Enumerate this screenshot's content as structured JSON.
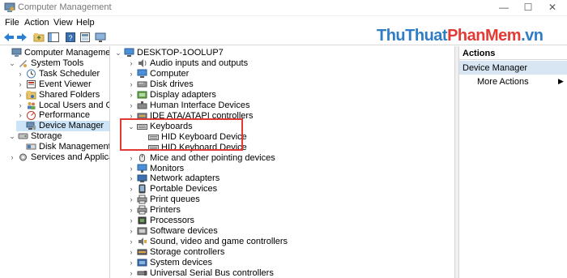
{
  "window": {
    "title": "Computer Management",
    "minimize_glyph": "—",
    "maximize_glyph": "☐",
    "close_glyph": "✕"
  },
  "menu": [
    "File",
    "Action",
    "View",
    "Help"
  ],
  "watermark": {
    "part1": "ThuThuat",
    "part2": "PhanMem",
    "part3": ".vn"
  },
  "left_tree": [
    {
      "label": "Computer Management (Local",
      "icon": "computer-management-icon",
      "expander": ""
    },
    {
      "label": "System Tools",
      "icon": "tools-icon",
      "expander": "⌄"
    },
    {
      "label": "Task Scheduler",
      "icon": "clock-icon",
      "expander": "›"
    },
    {
      "label": "Event Viewer",
      "icon": "event-viewer-icon",
      "expander": "›"
    },
    {
      "label": "Shared Folders",
      "icon": "shared-folder-icon",
      "expander": "›"
    },
    {
      "label": "Local Users and Groups",
      "icon": "users-icon",
      "expander": "›"
    },
    {
      "label": "Performance",
      "icon": "performance-icon",
      "expander": "›"
    },
    {
      "label": "Device Manager",
      "icon": "device-manager-icon",
      "expander": "",
      "selected": true
    },
    {
      "label": "Storage",
      "icon": "storage-icon",
      "expander": "⌄"
    },
    {
      "label": "Disk Management",
      "icon": "disk-management-icon",
      "expander": ""
    },
    {
      "label": "Services and Applications",
      "icon": "services-icon",
      "expander": "›"
    }
  ],
  "device_tree": {
    "root": "DESKTOP-1OOLUP7",
    "items": [
      {
        "label": "Audio inputs and outputs",
        "icon": "audio-icon",
        "expander": "›"
      },
      {
        "label": "Computer",
        "icon": "computer-icon",
        "expander": "›"
      },
      {
        "label": "Disk drives",
        "icon": "disk-icon",
        "expander": "›"
      },
      {
        "label": "Display adapters",
        "icon": "display-icon",
        "expander": "›"
      },
      {
        "label": "Human Interface Devices",
        "icon": "hid-icon",
        "expander": "›"
      },
      {
        "label": "IDE ATA/ATAPI controllers",
        "icon": "ide-icon",
        "expander": "›"
      },
      {
        "label": "Keyboards",
        "icon": "keyboard-icon",
        "expander": "⌄"
      },
      {
        "label": "HID Keyboard Device",
        "icon": "keyboard-icon",
        "expander": "",
        "child": true
      },
      {
        "label": "HID Keyboard Device",
        "icon": "keyboard-icon",
        "expander": "",
        "child": true
      },
      {
        "label": "Mice and other pointing devices",
        "icon": "mouse-icon",
        "expander": "›"
      },
      {
        "label": "Monitors",
        "icon": "monitor-icon",
        "expander": "›"
      },
      {
        "label": "Network adapters",
        "icon": "network-icon",
        "expander": "›"
      },
      {
        "label": "Portable Devices",
        "icon": "portable-icon",
        "expander": "›"
      },
      {
        "label": "Print queues",
        "icon": "printer-icon",
        "expander": "›"
      },
      {
        "label": "Printers",
        "icon": "printer-icon",
        "expander": "›"
      },
      {
        "label": "Processors",
        "icon": "processor-icon",
        "expander": "›"
      },
      {
        "label": "Software devices",
        "icon": "software-icon",
        "expander": "›"
      },
      {
        "label": "Sound, video and game controllers",
        "icon": "sound-icon",
        "expander": "›"
      },
      {
        "label": "Storage controllers",
        "icon": "storage-controller-icon",
        "expander": "›"
      },
      {
        "label": "System devices",
        "icon": "system-icon",
        "expander": "›"
      },
      {
        "label": "Universal Serial Bus controllers",
        "icon": "usb-icon",
        "expander": "›"
      }
    ]
  },
  "actions": {
    "header": "Actions",
    "section": "Device Manager",
    "more": "More Actions",
    "more_arrow": "▶"
  },
  "colors": {
    "selection": "#cce4f7",
    "highlight_box": "#e23b36",
    "watermark_blue": "#2f7cc7",
    "watermark_red": "#e23b36"
  }
}
